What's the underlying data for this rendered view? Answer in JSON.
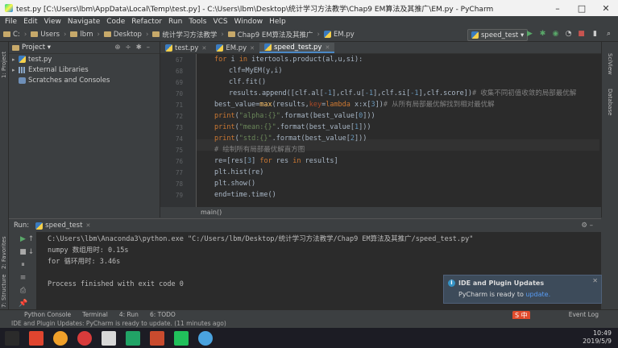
{
  "window": {
    "title": "test.py [C:\\Users\\lbm\\AppData\\Local\\Temp\\test.py] - C:\\Users\\lbm\\Desktop\\统计学习方法教学\\Chap9 EM算法及其推广\\EM.py - PyCharm",
    "min": "–",
    "max": "□",
    "close": "✕"
  },
  "menu": [
    "File",
    "Edit",
    "View",
    "Navigate",
    "Code",
    "Refactor",
    "Run",
    "Tools",
    "VCS",
    "Window",
    "Help"
  ],
  "nav": {
    "crumbs": [
      "C:",
      "Users",
      "lbm",
      "Desktop",
      "统计学习方法教学",
      "Chap9 EM算法及其推广",
      "EM.py"
    ],
    "run_config": "speed_test ▾"
  },
  "project": {
    "header": "Project ▾",
    "items": [
      "test.py",
      "External Libraries",
      "Scratches and Consoles"
    ]
  },
  "tabs": [
    "test.py",
    "EM.py",
    "speed_test.py"
  ],
  "editor": {
    "line_numbers": [
      "67",
      "68",
      "69",
      "70",
      "71",
      "72",
      "73",
      "74",
      "75",
      "76",
      "77",
      "78",
      "79"
    ],
    "breadcrumb": "main()"
  },
  "run": {
    "header_label": "Run:",
    "config": "speed_test",
    "console": [
      "C:\\Users\\lbm\\Anaconda3\\python.exe \"C:/Users/lbm/Desktop/统计学习方法教学/Chap9 EM算法及其推广/speed_test.py\"",
      "numpy 数组用时: 0.15s",
      "for 循环用时: 3.46s",
      "",
      "Process finished with exit code 0"
    ]
  },
  "notification": {
    "title": "IDE and Plugin Updates",
    "message": "PyCharm is ready to ",
    "link": "update."
  },
  "tool_windows": [
    "Python Console",
    "Terminal",
    "4: Run",
    "6: TODO"
  ],
  "event_log": "Event Log",
  "status": "IDE and Plugin Updates: PyCharm is ready to update. (11 minutes ago)",
  "tray": {
    "time": "10:49",
    "date": "2019/5/9"
  },
  "side_labels": {
    "left1": "1: Project",
    "left2": "2: Favorites",
    "left3": "7: Structure",
    "right1": "SciView",
    "right2": "Database"
  }
}
